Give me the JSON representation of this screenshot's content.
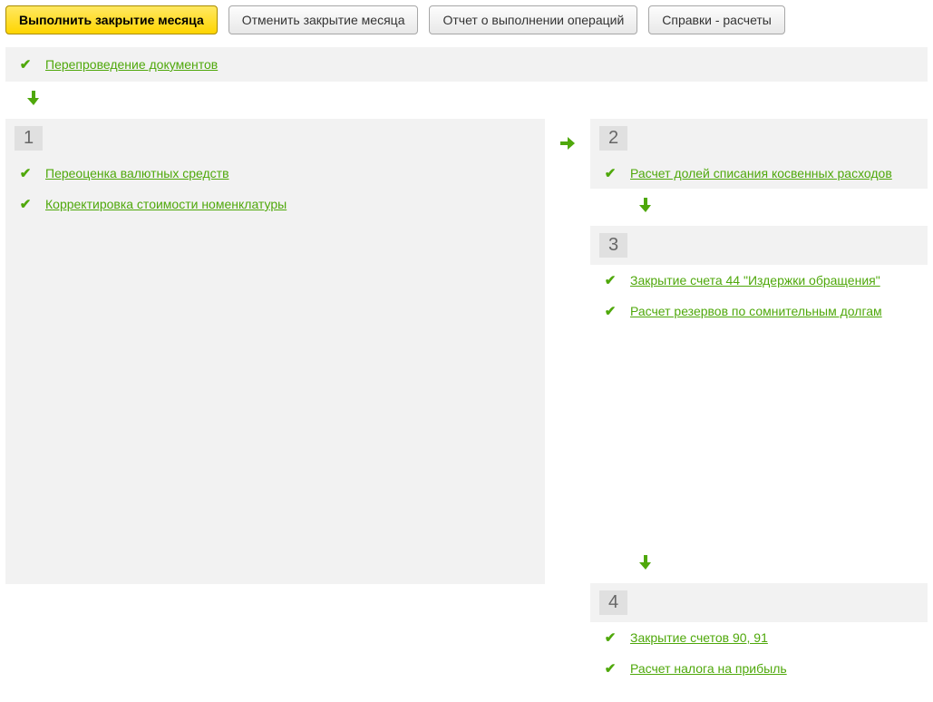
{
  "toolbar": {
    "execute": "Выполнить закрытие месяца",
    "cancel": "Отменить закрытие месяца",
    "report": "Отчет о выполнении операций",
    "refs": "Справки - расчеты"
  },
  "top_op": "Перепроведение документов",
  "step1": {
    "num": "1",
    "ops": [
      "Переоценка валютных средств",
      "Корректировка стоимости номенклатуры"
    ]
  },
  "step2": {
    "num": "2",
    "ops": [
      "Расчет долей списания косвенных расходов"
    ]
  },
  "step3": {
    "num": "3",
    "ops": [
      "Закрытие счета 44 \"Издержки обращения\"",
      "Расчет резервов по сомнительным долгам"
    ]
  },
  "step4": {
    "num": "4",
    "ops": [
      "Закрытие счетов 90, 91",
      "Расчет налога на прибыль"
    ]
  }
}
